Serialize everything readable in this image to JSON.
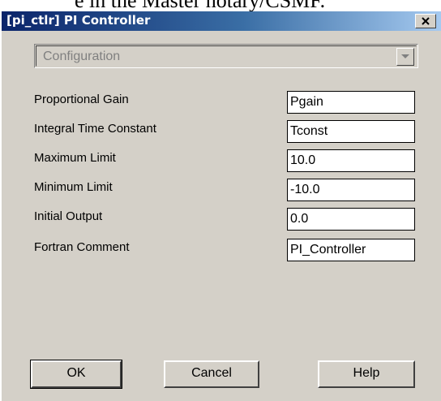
{
  "background_text": "e in the Master notary/CSMF.",
  "dialog": {
    "title": "[pi_ctlr] PI Controller",
    "close_glyph": "x",
    "category_select": {
      "value": "Configuration",
      "disabled": true
    },
    "fields": [
      {
        "label": "Proportional Gain",
        "value": "Pgain"
      },
      {
        "label": "Integral Time Constant",
        "value": "Tconst"
      },
      {
        "label": "Maximum Limit",
        "value": "10.0"
      },
      {
        "label": "Minimum Limit",
        "value": "-10.0"
      },
      {
        "label": "Initial Output",
        "value": "0.0"
      },
      {
        "label": "Fortran Comment",
        "value": "PI_Controller"
      }
    ],
    "buttons": {
      "ok": "OK",
      "cancel": "Cancel",
      "help": "Help"
    }
  },
  "colors": {
    "title_gradient_start": "#0a246a",
    "title_gradient_end": "#a6caf0",
    "dialog_face": "#d4d0c8"
  }
}
